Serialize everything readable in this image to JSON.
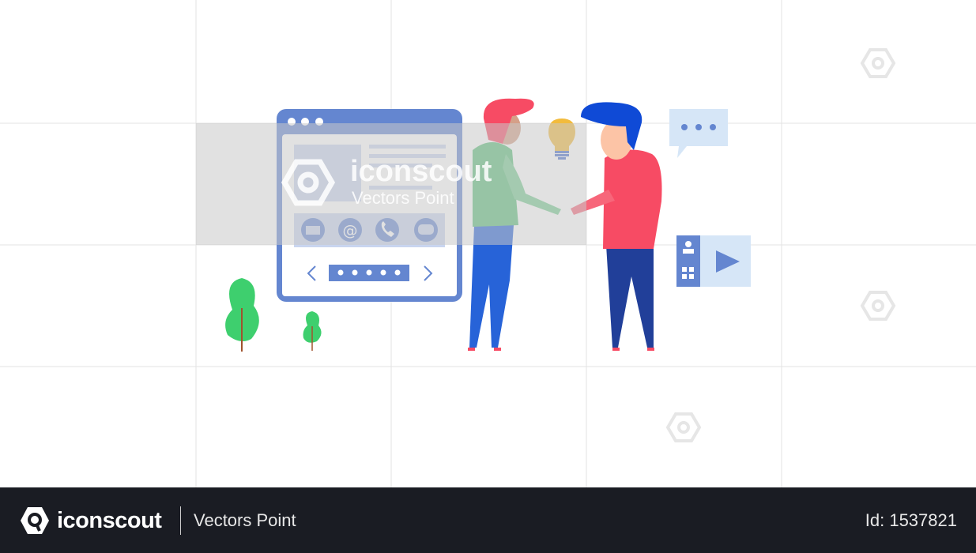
{
  "watermark": {
    "brand": "iconscout",
    "author": "Vectors Point"
  },
  "footer": {
    "brand": "iconscout",
    "author": "Vectors Point",
    "asset_id": "Id: 1537821"
  },
  "colors": {
    "footer_bg": "#1a1c23",
    "browser_blue": "#6486d0",
    "shirt_green": "#5cbf7a",
    "shirt_red": "#f74b64",
    "hair_blue": "#0f4ad6",
    "pants_blue": "#2763d8",
    "tree_green": "#3ecf6e"
  }
}
